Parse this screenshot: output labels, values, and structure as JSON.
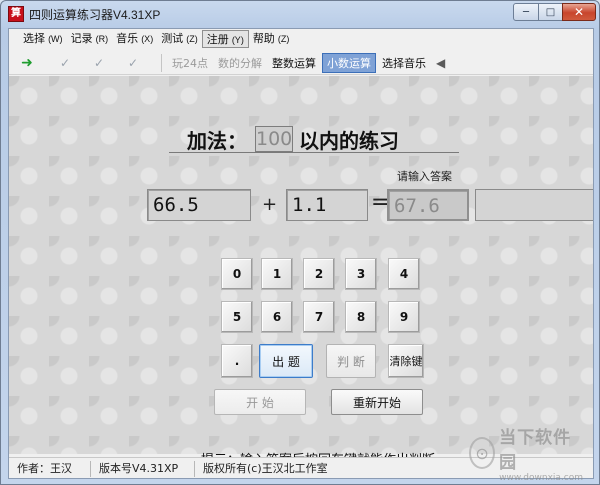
{
  "window": {
    "title": "四则运算练习器V4.31XP",
    "app_icon_glyph": "算",
    "controls": {
      "minimize": "─",
      "maximize": "□",
      "close": "✕"
    }
  },
  "menu": [
    {
      "label": "选择",
      "hotkey": "(W)"
    },
    {
      "label": "记录",
      "hotkey": "(R)"
    },
    {
      "label": "音乐",
      "hotkey": "(X)"
    },
    {
      "label": "测试",
      "hotkey": "(Z)"
    },
    {
      "label": "注册",
      "hotkey": "(Y)"
    },
    {
      "label": "帮助",
      "hotkey": "(Z)"
    }
  ],
  "toolbar": {
    "icons": [
      {
        "name": "start-arrow-icon",
        "glyph": "➜"
      },
      {
        "name": "check-icon-1",
        "glyph": "✓"
      },
      {
        "name": "check-icon-2",
        "glyph": "✓"
      },
      {
        "name": "check-icon-3",
        "glyph": "✓"
      }
    ],
    "play24": "玩24点",
    "decompose": "数的分解",
    "integer": "整数运算",
    "decimal": "小数运算",
    "music": "选择音乐",
    "speaker_glyph": "◀"
  },
  "main": {
    "heading_prefix": "加法：",
    "limit": "100",
    "heading_suffix": "以内的练习",
    "prompt": "请输入答案",
    "operand1": "66.5",
    "operator": "+",
    "operand2": "1.1",
    "equals": "=",
    "answer": "67.6",
    "keypad": [
      "0",
      "1",
      "2",
      "3",
      "4",
      "5",
      "6",
      "7",
      "8",
      "9",
      "."
    ],
    "buttons": {
      "chuti": "出 题",
      "panduan": "判 断",
      "clear": "清除键",
      "start": "开 始",
      "restart": "重新开始"
    },
    "hint": "提示：输入答案后按回车键就能作出判断。"
  },
  "status": {
    "author": "作者：王汉北",
    "version": "版本号V4.31XP",
    "copyright": "版权所有(c)王汉北工作室"
  },
  "watermark": {
    "main": "当下软件园",
    "url": "www.downxia.com"
  }
}
